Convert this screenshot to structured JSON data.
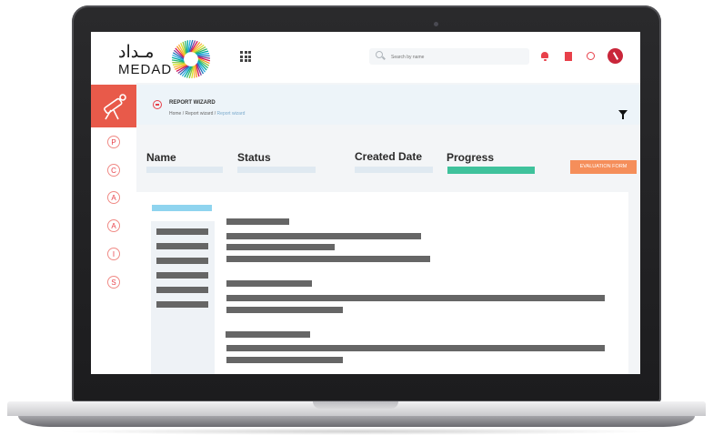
{
  "app": {
    "logo_arabic": "مـداد",
    "logo_latin": "MEDAD"
  },
  "header": {
    "search_placeholder": "Search by name",
    "icons": [
      "apps-grid-icon",
      "search-icon",
      "bell-icon",
      "bookmark-icon",
      "globe-icon",
      "user-avatar"
    ],
    "accent_color": "#e8404a"
  },
  "sidebar": {
    "letters": [
      "P",
      "C",
      "A",
      "A",
      "I",
      "S"
    ]
  },
  "page": {
    "title": "REPORT WIZARD",
    "breadcrumb": [
      "Home",
      "Report wizard",
      "Report wizard"
    ]
  },
  "columns": {
    "name": "Name",
    "status": "Status",
    "created_date": "Created Date",
    "progress": "Progress",
    "progress_value": 1.0
  },
  "actions": {
    "evaluation_form": "EVALUATION FORM"
  },
  "colors": {
    "sidebar_brand": "#e85a4a",
    "progress": "#3fc29c",
    "evaluation_button": "#f58e5a",
    "accent_bar": "#8fd4ef"
  }
}
